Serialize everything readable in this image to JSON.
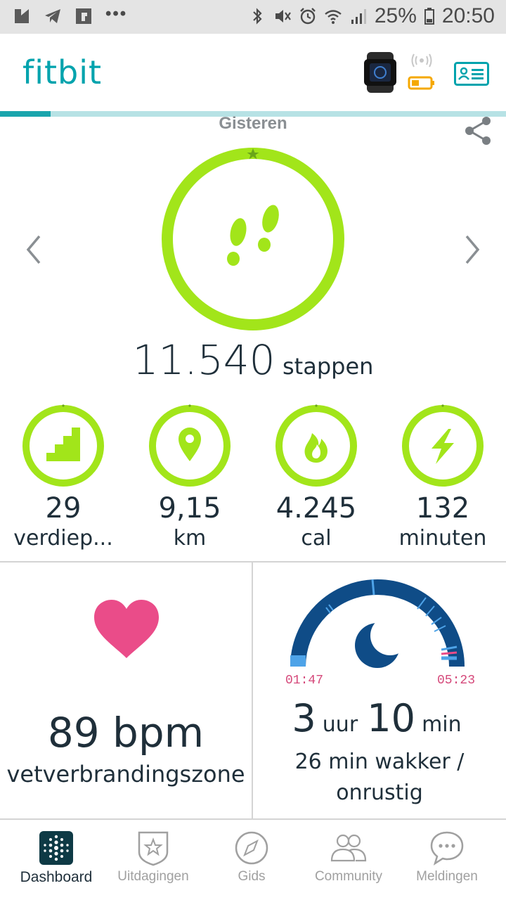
{
  "status_bar": {
    "battery_percent": "25%",
    "time": "20:50"
  },
  "header": {
    "logo": "fitbit",
    "device_battery_color": "#f5a800"
  },
  "colors": {
    "accent": "#00a3ad",
    "ring_green": "#a2e51a",
    "heart_pink": "#ea4c89",
    "sleep_dark": "#0f4c87",
    "sleep_light": "#4ea3e8"
  },
  "dashboard": {
    "day_label": "Gisteren",
    "steps": {
      "value": "11.540",
      "unit": "stappen",
      "goal_progress": 1.0
    },
    "stats": [
      {
        "icon": "stairs-icon",
        "value": "29",
        "label": "verdiep..."
      },
      {
        "icon": "location-pin-icon",
        "value": "9,15",
        "label": "km"
      },
      {
        "icon": "flame-icon",
        "value": "4.245",
        "label": "cal"
      },
      {
        "icon": "lightning-icon",
        "value": "132",
        "label": "minuten"
      }
    ],
    "heart": {
      "value": "89 bpm",
      "zone": "vetverbrandingszone"
    },
    "sleep": {
      "start": "01:47",
      "end": "05:23",
      "hours": "3",
      "hours_unit": "uur",
      "minutes": "10",
      "minutes_unit": "min",
      "awake_line1": "26 min wakker /",
      "awake_line2": "onrustig"
    }
  },
  "bottom_nav": [
    {
      "icon": "dashboard-icon",
      "label": "Dashboard",
      "active": true
    },
    {
      "icon": "star-badge-icon",
      "label": "Uitdagingen",
      "active": false
    },
    {
      "icon": "compass-icon",
      "label": "Gids",
      "active": false
    },
    {
      "icon": "community-icon",
      "label": "Community",
      "active": false
    },
    {
      "icon": "chat-bubble-icon",
      "label": "Meldingen",
      "active": false
    }
  ]
}
